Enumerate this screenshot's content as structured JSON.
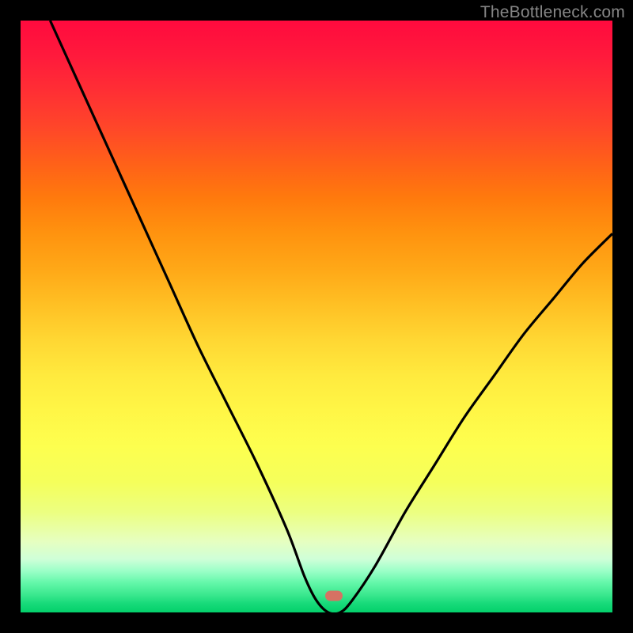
{
  "attribution": "TheBottleneck.com",
  "marker": {
    "x_frac": 0.53,
    "y_frac": 0.972,
    "color": "#d67263"
  },
  "chart_data": {
    "type": "line",
    "title": "",
    "xlabel": "",
    "ylabel": "",
    "xlim": [
      0,
      100
    ],
    "ylim": [
      0,
      100
    ],
    "grid": false,
    "legend": false,
    "annotations": [],
    "series": [
      {
        "name": "bottleneck-curve",
        "x": [
          5,
          10,
          15,
          20,
          25,
          30,
          35,
          40,
          45,
          48,
          50,
          52,
          54,
          56,
          60,
          65,
          70,
          75,
          80,
          85,
          90,
          95,
          100
        ],
        "y": [
          100,
          89,
          78,
          67,
          56,
          45,
          35,
          25,
          14,
          6,
          2,
          0,
          0,
          2,
          8,
          17,
          25,
          33,
          40,
          47,
          53,
          59,
          64
        ]
      }
    ],
    "background_gradient": {
      "top": "#ff0a3e",
      "mid": "#ffe63e",
      "bottom": "#04d06b"
    },
    "marker_point": {
      "x": 53,
      "y": 3
    }
  }
}
